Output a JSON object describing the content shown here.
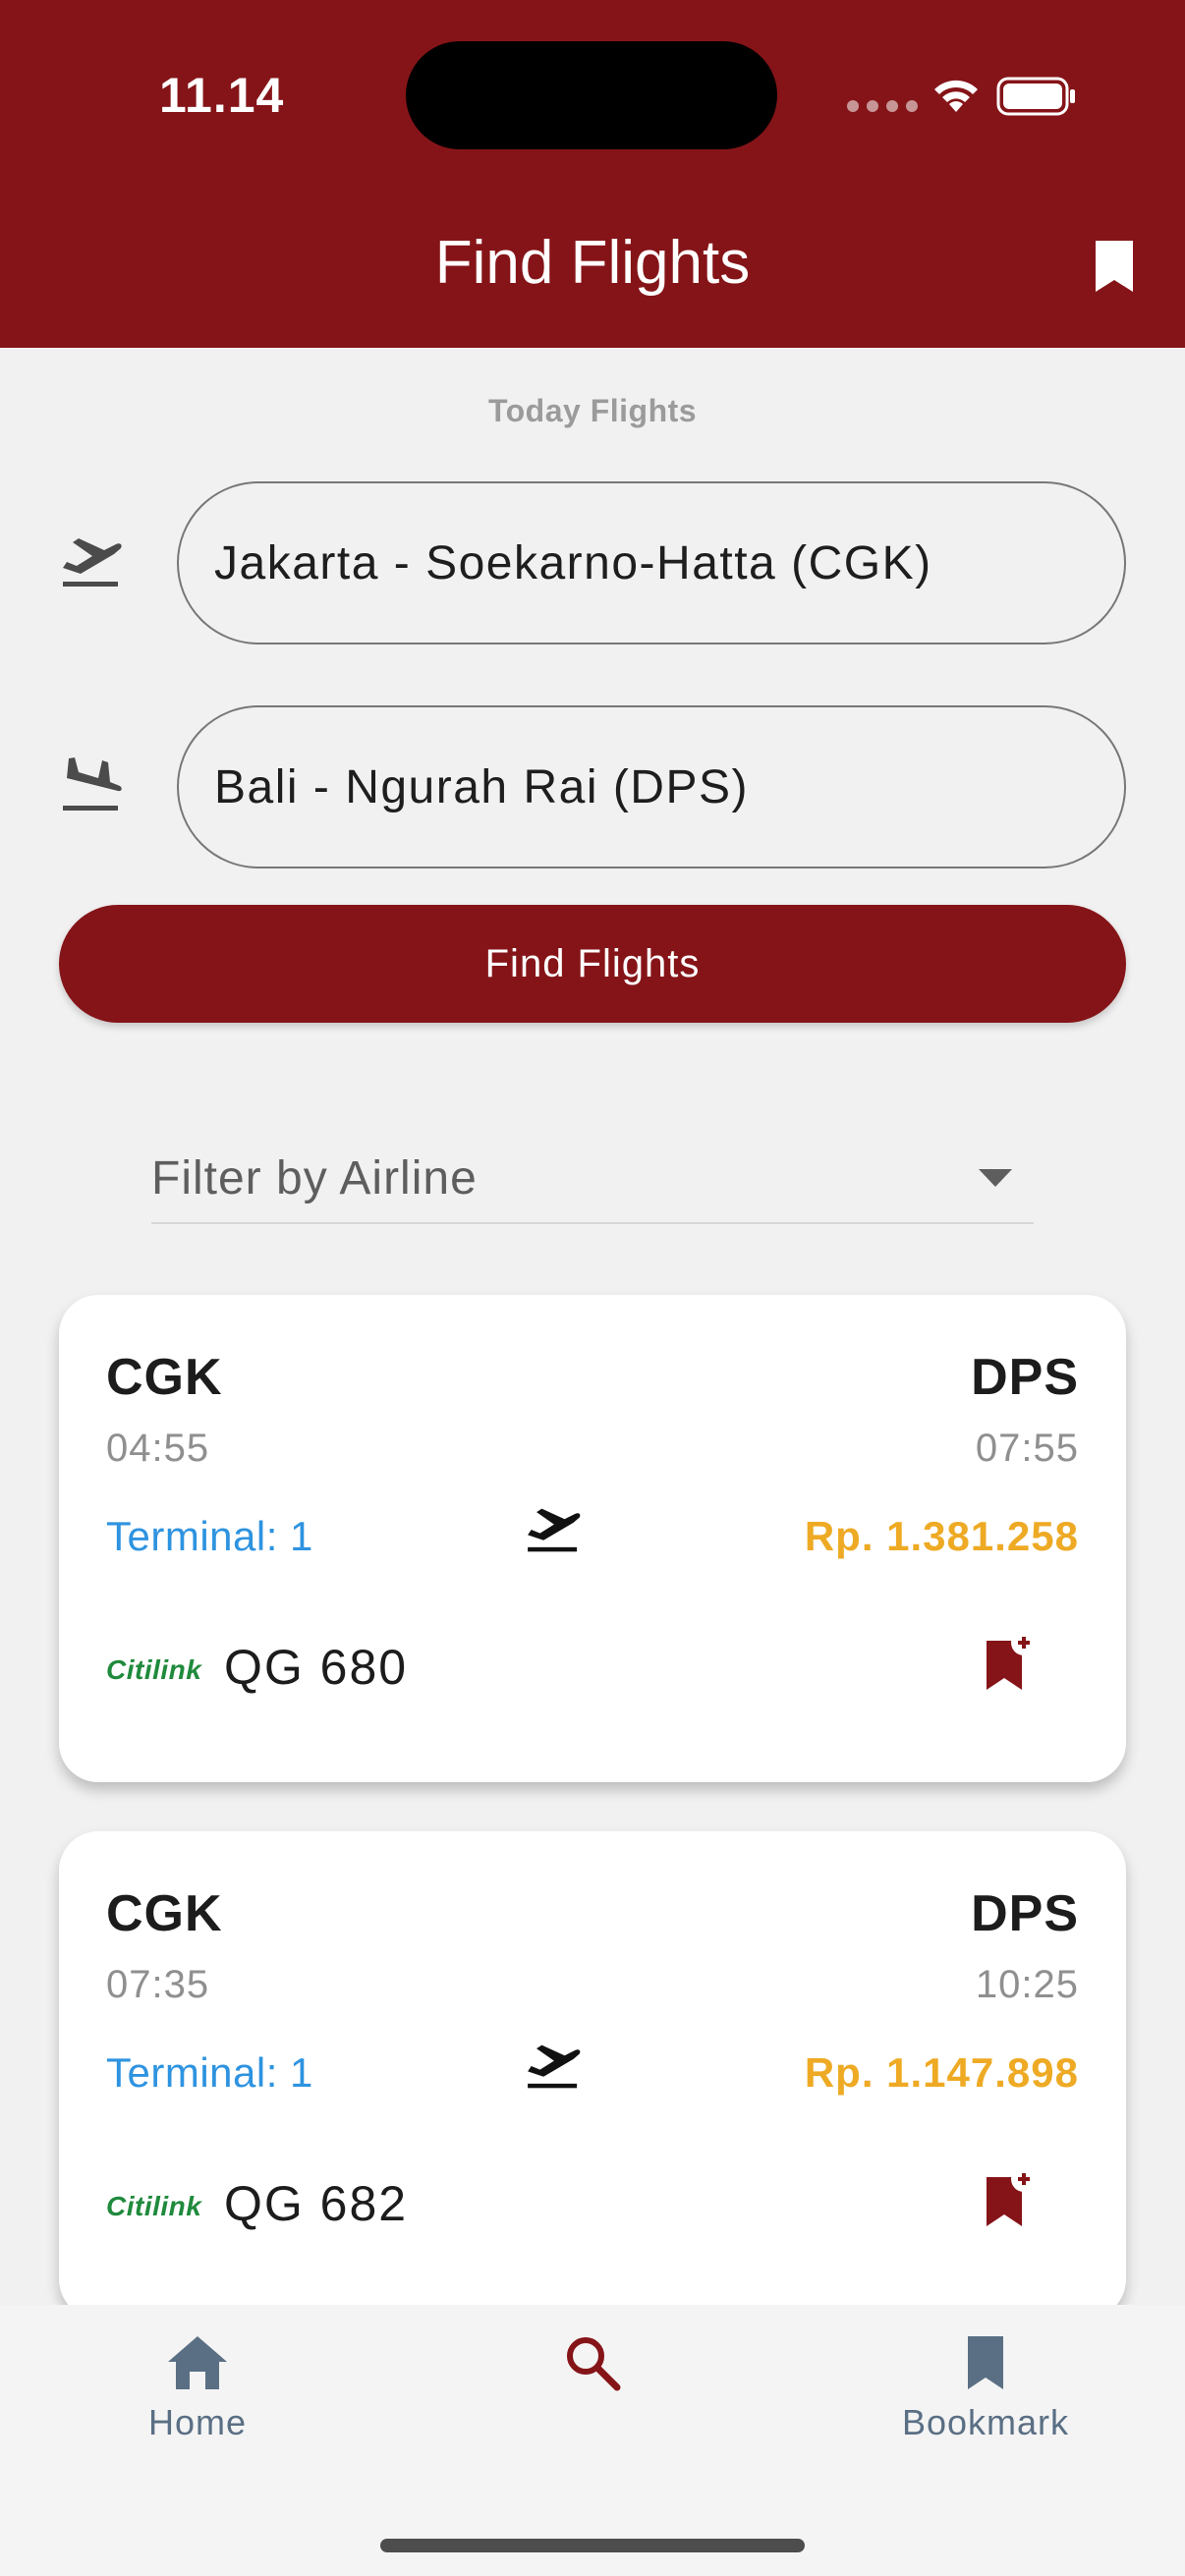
{
  "status_bar": {
    "time": "11.14"
  },
  "header": {
    "title": "Find Flights"
  },
  "section_label": "Today Flights",
  "search": {
    "departure_value": "Jakarta - Soekarno-Hatta (CGK)",
    "arrival_value": "Bali - Ngurah Rai (DPS)",
    "button_label": "Find Flights"
  },
  "filter": {
    "label": "Filter by Airline"
  },
  "flights": [
    {
      "from": "CGK",
      "to": "DPS",
      "depart_time": "04:55",
      "arrive_time": "07:55",
      "terminal": "Terminal: 1",
      "price": "Rp. 1.381.258",
      "airline_logo": "Citilink",
      "flight_number": "QG 680"
    },
    {
      "from": "CGK",
      "to": "DPS",
      "depart_time": "07:35",
      "arrive_time": "10:25",
      "terminal": "Terminal: 1",
      "price": "Rp. 1.147.898",
      "airline_logo": "Citilink",
      "flight_number": "QG 682"
    }
  ],
  "nav": {
    "home_label": "Home",
    "search_label": "",
    "bookmark_label": "Bookmark"
  },
  "colors": {
    "primary": "#851418",
    "terminal": "#2e93e0",
    "price": "#eeaa24",
    "nav_inactive": "#5a6f84"
  }
}
